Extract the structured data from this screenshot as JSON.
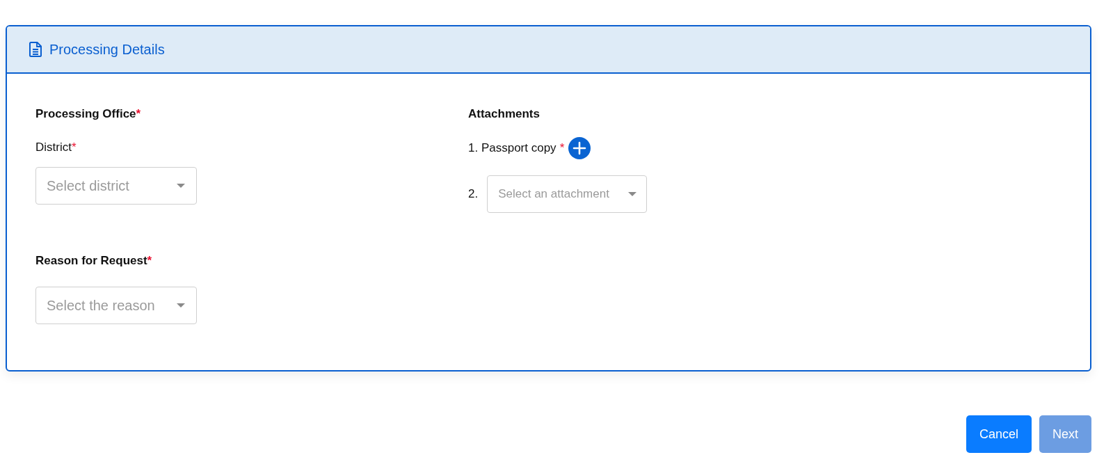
{
  "card": {
    "title": "Processing Details"
  },
  "processing_office": {
    "label": "Processing Office",
    "required_mark": "*",
    "district": {
      "label": "District",
      "required_mark": "*",
      "placeholder": "Select district"
    }
  },
  "reason": {
    "label": "Reason for Request",
    "required_mark": "*",
    "placeholder": "Select the reason"
  },
  "attachments": {
    "title": "Attachments",
    "items": [
      {
        "kind": "document",
        "label": "1. Passport copy",
        "required_mark": "*"
      },
      {
        "kind": "select",
        "number": "2.",
        "placeholder": "Select an attachment"
      }
    ]
  },
  "buttons": [
    {
      "label": "Cancel",
      "disabled": false
    },
    {
      "label": "Next",
      "disabled": true
    }
  ]
}
